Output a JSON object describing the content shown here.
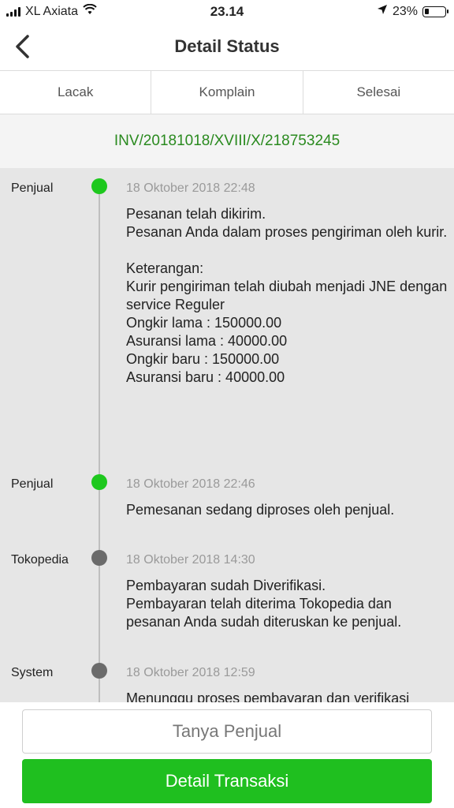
{
  "status_bar": {
    "carrier": "XL Axiata",
    "time": "23.14",
    "battery": "23%",
    "battery_level": 0.23
  },
  "header": {
    "title": "Detail Status"
  },
  "tabs": [
    {
      "label": "Lacak"
    },
    {
      "label": "Komplain"
    },
    {
      "label": "Selesai"
    }
  ],
  "invoice": "INV/20181018/XVIII/X/218753245",
  "timeline": [
    {
      "actor": "Penjual",
      "time": "18 Oktober 2018 22:48",
      "message": "Pesanan telah dikirim.\nPesanan Anda dalam proses pengiriman oleh kurir.\n\nKeterangan:\nKurir pengiriman telah diubah menjadi JNE dengan service Reguler\n        Ongkir lama : 150000.00\nAsuransi lama : 40000.00\nOngkir baru : 150000.00\nAsuransi baru : 40000.00",
      "dot_color": "#1ec81e"
    },
    {
      "actor": "Penjual",
      "time": "18 Oktober 2018 22:46",
      "message": "Pemesanan sedang diproses oleh penjual.",
      "dot_color": "#1ec81e"
    },
    {
      "actor": "Tokopedia",
      "time": "18 Oktober 2018 14:30",
      "message": "Pembayaran sudah Diverifikasi.\nPembayaran telah diterima Tokopedia dan pesanan Anda sudah diteruskan ke penjual.",
      "dot_color": "#6b6b6b"
    },
    {
      "actor": "System",
      "time": "18 Oktober 2018 12:59",
      "message": "Menunggu proses pembayaran dan verifikasi",
      "dot_color": "#6b6b6b"
    }
  ],
  "footer": {
    "ask_seller": "Tanya Penjual",
    "transaction_detail": "Detail Transaksi"
  },
  "colors": {
    "accent": "#1fbf1f",
    "invoice": "#2a8a1f"
  }
}
